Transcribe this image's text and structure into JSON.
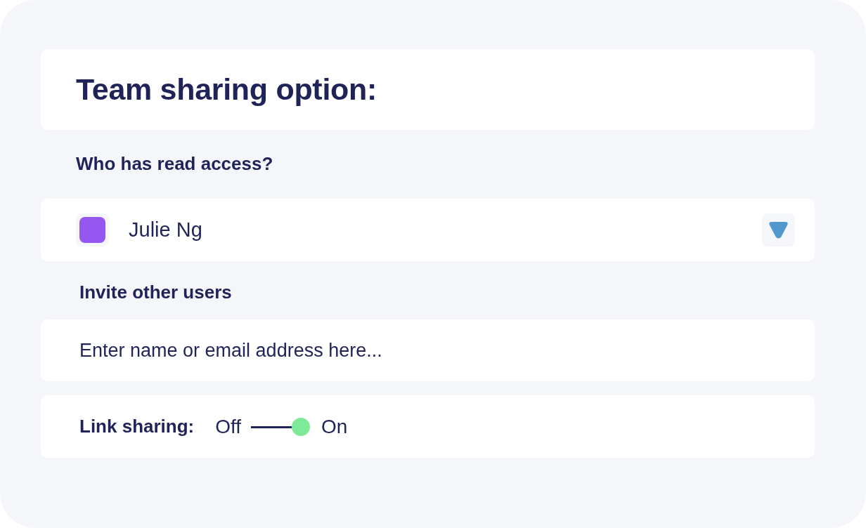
{
  "title": "Team sharing option:",
  "read_access": {
    "heading": "Who has read access?",
    "users": [
      {
        "name": "Julie Ng",
        "color": "#9457f0"
      }
    ]
  },
  "invite": {
    "heading": "Invite other users",
    "placeholder": "Enter name or email address here..."
  },
  "link_sharing": {
    "label": "Link sharing:",
    "off_label": "Off",
    "on_label": "On",
    "on": true
  }
}
